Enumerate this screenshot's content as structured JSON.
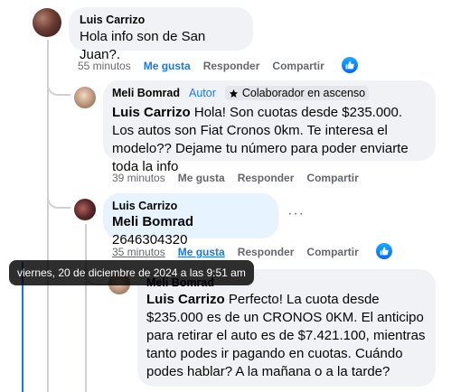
{
  "comments": [
    {
      "author": "Luis Carrizo",
      "text": "Hola info son de San Juan?.",
      "time": "55 minutos",
      "like": "Me gusta",
      "reply": "Responder",
      "share": "Compartir"
    },
    {
      "author": "Meli Bomrad",
      "badge_author": "Autor",
      "badge_collab": "Colaborador en ascenso",
      "mention": "Luis Carrizo",
      "text": "Hola! Son cuotas desde $235.000. Los autos son Fiat Cronos 0km. Te interesa el modelo?? Dejame tu número para poder enviarte toda la info",
      "time": "39 minutos",
      "like": "Me gusta",
      "reply": "Responder",
      "share": "Compartir"
    },
    {
      "author": "Luis Carrizo",
      "mention": "Meli Bomrad",
      "text": "2646304320",
      "time": "35 minutos",
      "like": "Me gusta",
      "reply": "Responder",
      "share": "Compartir"
    },
    {
      "author": "Meli Bomrad",
      "mention": "Luis Carrizo",
      "text": "Perfecto! La cuota desde $235.000 es de un CRONOS 0KM. El anticipo para retirar el auto es de $7.421.100, mientras tanto podes ir pagando en cuotas. Cuándo podes hablar? A la mañana o a la tarde?"
    }
  ],
  "tooltip": "viernes, 20 de diciembre de 2024 a las 9:51 am",
  "more_menu": "···",
  "icons": {
    "like": "thumbs-up-icon",
    "star": "star-icon"
  },
  "colors": {
    "accent": "#1877f2",
    "bubble": "#f0f2f5",
    "bubble_active": "#e7f3ff"
  }
}
